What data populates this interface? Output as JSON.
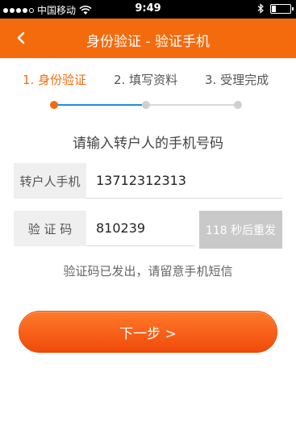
{
  "status_bar": {
    "carrier": "中国移动",
    "time": "9:49"
  },
  "nav": {
    "title": "身份验证 - 验证手机"
  },
  "steps": [
    {
      "label": "1. 身份验证",
      "active": true
    },
    {
      "label": "2. 填写资料",
      "active": false
    },
    {
      "label": "3. 受理完成",
      "active": false
    }
  ],
  "prompt": "请输入转户人的手机号码",
  "form": {
    "phone_label": "转户人手机",
    "phone_value": "13712312313",
    "code_label": "验 证 码",
    "code_value": "810239",
    "resend_label": "118 秒后重发"
  },
  "hint": "验证码已发出，请留意手机短信",
  "next_button": "下一步 >",
  "colors": {
    "accent": "#f36b0d",
    "progress_active": "#1f8fd6"
  }
}
